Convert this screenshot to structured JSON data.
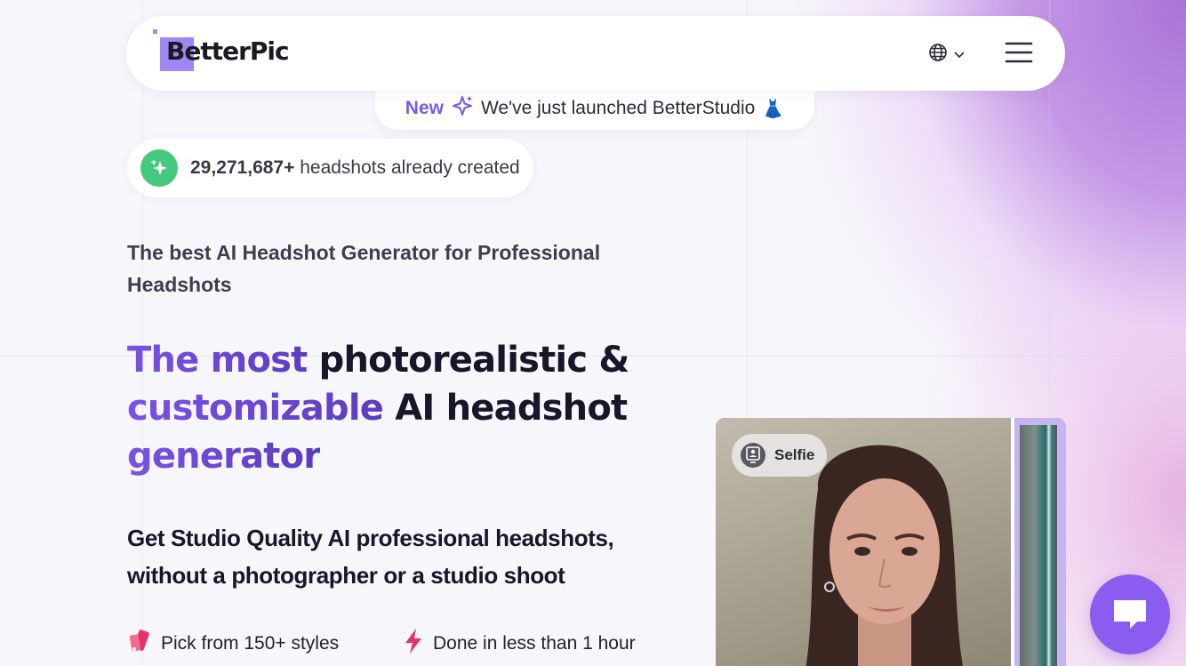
{
  "nav": {
    "logo_text": "BetterPic",
    "language_icon": "globe-icon",
    "menu_icon": "hamburger-icon"
  },
  "announcement": {
    "badge": "New",
    "text": "We've just launched BetterStudio",
    "emoji": "👗"
  },
  "counter": {
    "number": "29,271,687+",
    "text": "headshots already created"
  },
  "hero": {
    "subtitle": "The best AI Headshot Generator for Professional Headshots",
    "headline_part1": "The most ",
    "headline_part2": "photorealistic &",
    "headline_part3": "customizable ",
    "headline_part4": "AI headshot",
    "headline_part5": "generator",
    "description": "Get Studio Quality AI professional headshots, without a photographer or a studio shoot"
  },
  "features": [
    {
      "icon": "palette-icon",
      "label": "Pick from 150+ styles"
    },
    {
      "icon": "lightning-icon",
      "label": "Done in less than 1 hour"
    }
  ],
  "photo": {
    "tag": "Selfie"
  },
  "colors": {
    "accent": "#8b5cf0",
    "brand_purple": "#9f86f2",
    "green": "#45c97f",
    "pink": "#e8306a"
  }
}
